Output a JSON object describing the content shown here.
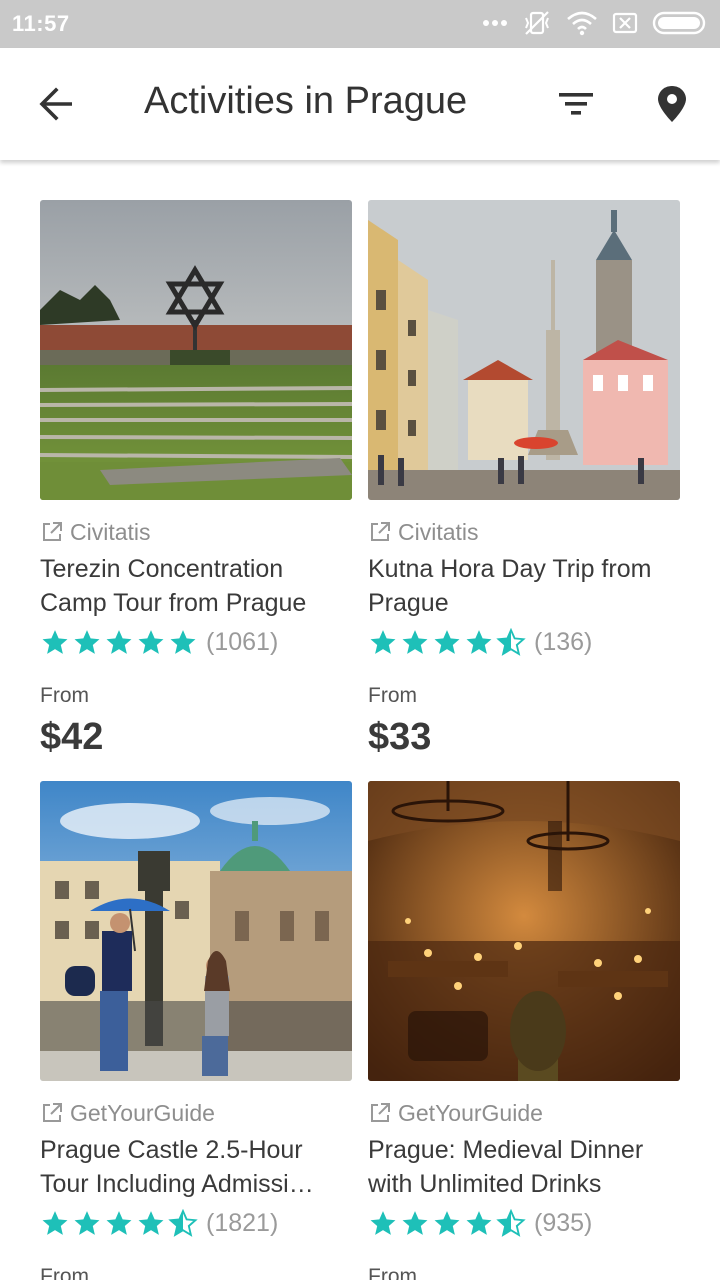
{
  "status": {
    "time": "11:57"
  },
  "header": {
    "title": "Activities in Prague"
  },
  "activities": [
    {
      "provider": "Civitatis",
      "name": "Terezin Concentration Camp Tour from Prague",
      "rating": 5,
      "reviews": "(1061)",
      "from_label": "From",
      "price": "$42"
    },
    {
      "provider": "Civitatis",
      "name": "Kutna Hora Day Trip from Prague",
      "rating": 4.5,
      "reviews": "(136)",
      "from_label": "From",
      "price": "$33"
    },
    {
      "provider": "GetYourGuide",
      "name": "Prague Castle 2.5-Hour Tour Including Admissi…",
      "rating": 4.5,
      "reviews": "(1821)",
      "from_label": "From",
      "price": ""
    },
    {
      "provider": "GetYourGuide",
      "name": "Prague: Medieval Dinner with Unlimited Drinks",
      "rating": 4.5,
      "reviews": "(935)",
      "from_label": "From",
      "price": ""
    }
  ],
  "colors": {
    "star": "#1ec0b8",
    "statusbar": "#c9c9c9"
  }
}
